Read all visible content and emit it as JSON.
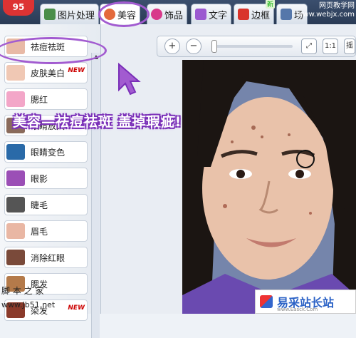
{
  "app": {
    "logo_text": "95"
  },
  "tabs": [
    {
      "label": "图片处理",
      "icon": "image-processing-icon",
      "active": false
    },
    {
      "label": "美容",
      "icon": "beauty-icon",
      "active": true
    },
    {
      "label": "饰品",
      "icon": "accessory-icon",
      "active": false
    },
    {
      "label": "文字",
      "icon": "text-icon",
      "active": false
    },
    {
      "label": "边框",
      "icon": "frame-icon",
      "active": false
    },
    {
      "label": "场",
      "icon": "scene-icon",
      "active": false
    }
  ],
  "tab_new_badge": "新",
  "watermark_top": {
    "line1": "网页教学网",
    "line2": "www.webjx.com"
  },
  "sidebar": {
    "items": [
      {
        "label": "祛痘祛斑",
        "new": "",
        "thumb_color": "#e8b9a6"
      },
      {
        "label": "皮肤美白",
        "new": "NEW",
        "thumb_color": "#f0c8b4"
      },
      {
        "label": "腮红",
        "new": "",
        "thumb_color": "#f3a6c8"
      },
      {
        "label": "眼睛放大",
        "new": "",
        "thumb_color": "#8a6b5b"
      },
      {
        "label": "眼睛变色",
        "new": "",
        "thumb_color": "#2a6aa8"
      },
      {
        "label": "眼影",
        "new": "",
        "thumb_color": "#9b4fb6"
      },
      {
        "label": "睫毛",
        "new": "",
        "thumb_color": "#555555"
      },
      {
        "label": "眉毛",
        "new": "",
        "thumb_color": "#e9b7a4"
      },
      {
        "label": "消除红眼",
        "new": "",
        "thumb_color": "#7a4a3a"
      },
      {
        "label": "腮发",
        "new": "",
        "thumb_color": "#b47a4a"
      },
      {
        "label": "染发",
        "new": "NEW",
        "thumb_color": "#8a3a2a"
      }
    ]
  },
  "toolbar": {
    "zoom_in": "+",
    "zoom_out": "−",
    "fit_label": "⤢",
    "actual_size": "1:1",
    "extra_label": "摇"
  },
  "annotation": {
    "banner": "美容—祛痘祛斑 盖掉瑕疵!"
  },
  "watermarks": {
    "left_line1": "脚 本 之 家",
    "left_line2": "www.Jb51.net",
    "right_title": "易采站长站",
    "right_sub": "www.Easck.Com"
  },
  "colors": {
    "accent": "#a25bd0",
    "topbar": "#2a3b55",
    "new_badge": "#cc0000"
  }
}
